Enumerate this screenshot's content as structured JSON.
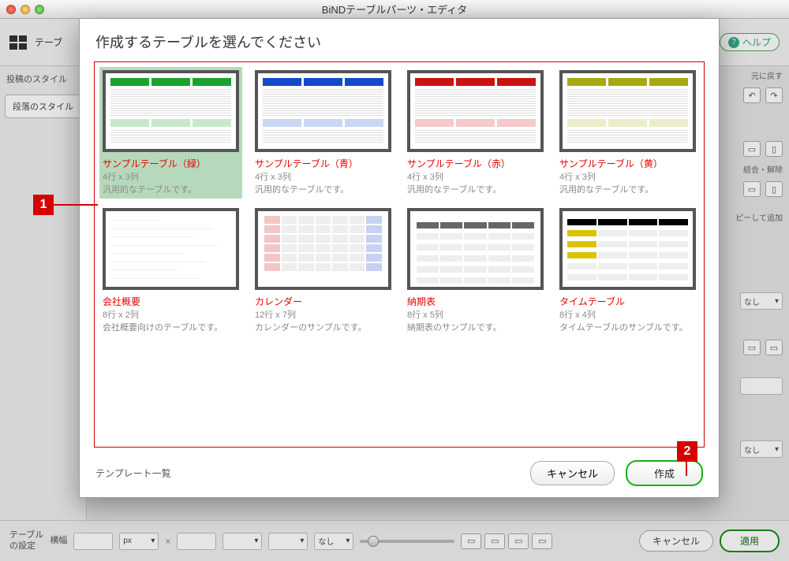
{
  "window": {
    "title": "BiNDテーブルパーツ・エディタ"
  },
  "bg": {
    "table_label": "テーブ",
    "help": "ヘルプ",
    "left_header": "投稿のスタイル",
    "left_button": "段落のスタイル",
    "right": {
      "undo_label": "元に戻す",
      "merge_label": "結合・解除",
      "copy_add": "ピーして追加",
      "none": "なし"
    },
    "bottom": {
      "table_settings": "テーブル\nの設定",
      "yoko": "横幅",
      "px": "px",
      "none": "なし",
      "cancel": "キャンセル",
      "apply": "適用"
    }
  },
  "modal": {
    "header": "作成するテーブルを選んでください",
    "footer_label": "テンプレート一覧",
    "cancel": "キャンセル",
    "create": "作成",
    "templates": [
      {
        "title": "サンプルテーブル（緑）",
        "dim": "4行 x 3列",
        "desc": "汎用的なテーブルです。"
      },
      {
        "title": "サンプルテーブル（青）",
        "dim": "4行 x 3列",
        "desc": "汎用的なテーブルです。"
      },
      {
        "title": "サンプルテーブル（赤）",
        "dim": "4行 x 3列",
        "desc": "汎用的なテーブルです。"
      },
      {
        "title": "サンプルテーブル（黄）",
        "dim": "4行 x 3列",
        "desc": "汎用的なテーブルです。"
      },
      {
        "title": "会社概要",
        "dim": "8行 x 2列",
        "desc": "会社概要向けのテーブルです。"
      },
      {
        "title": "カレンダー",
        "dim": "12行 x 7列",
        "desc": "カレンダーのサンプルです。"
      },
      {
        "title": "納期表",
        "dim": "8行 x 5列",
        "desc": "納期表のサンプルです。"
      },
      {
        "title": "タイムテーブル",
        "dim": "8行 x 4列",
        "desc": "タイムテーブルのサンプルです。"
      }
    ]
  },
  "callouts": {
    "one": "1",
    "two": "2"
  }
}
